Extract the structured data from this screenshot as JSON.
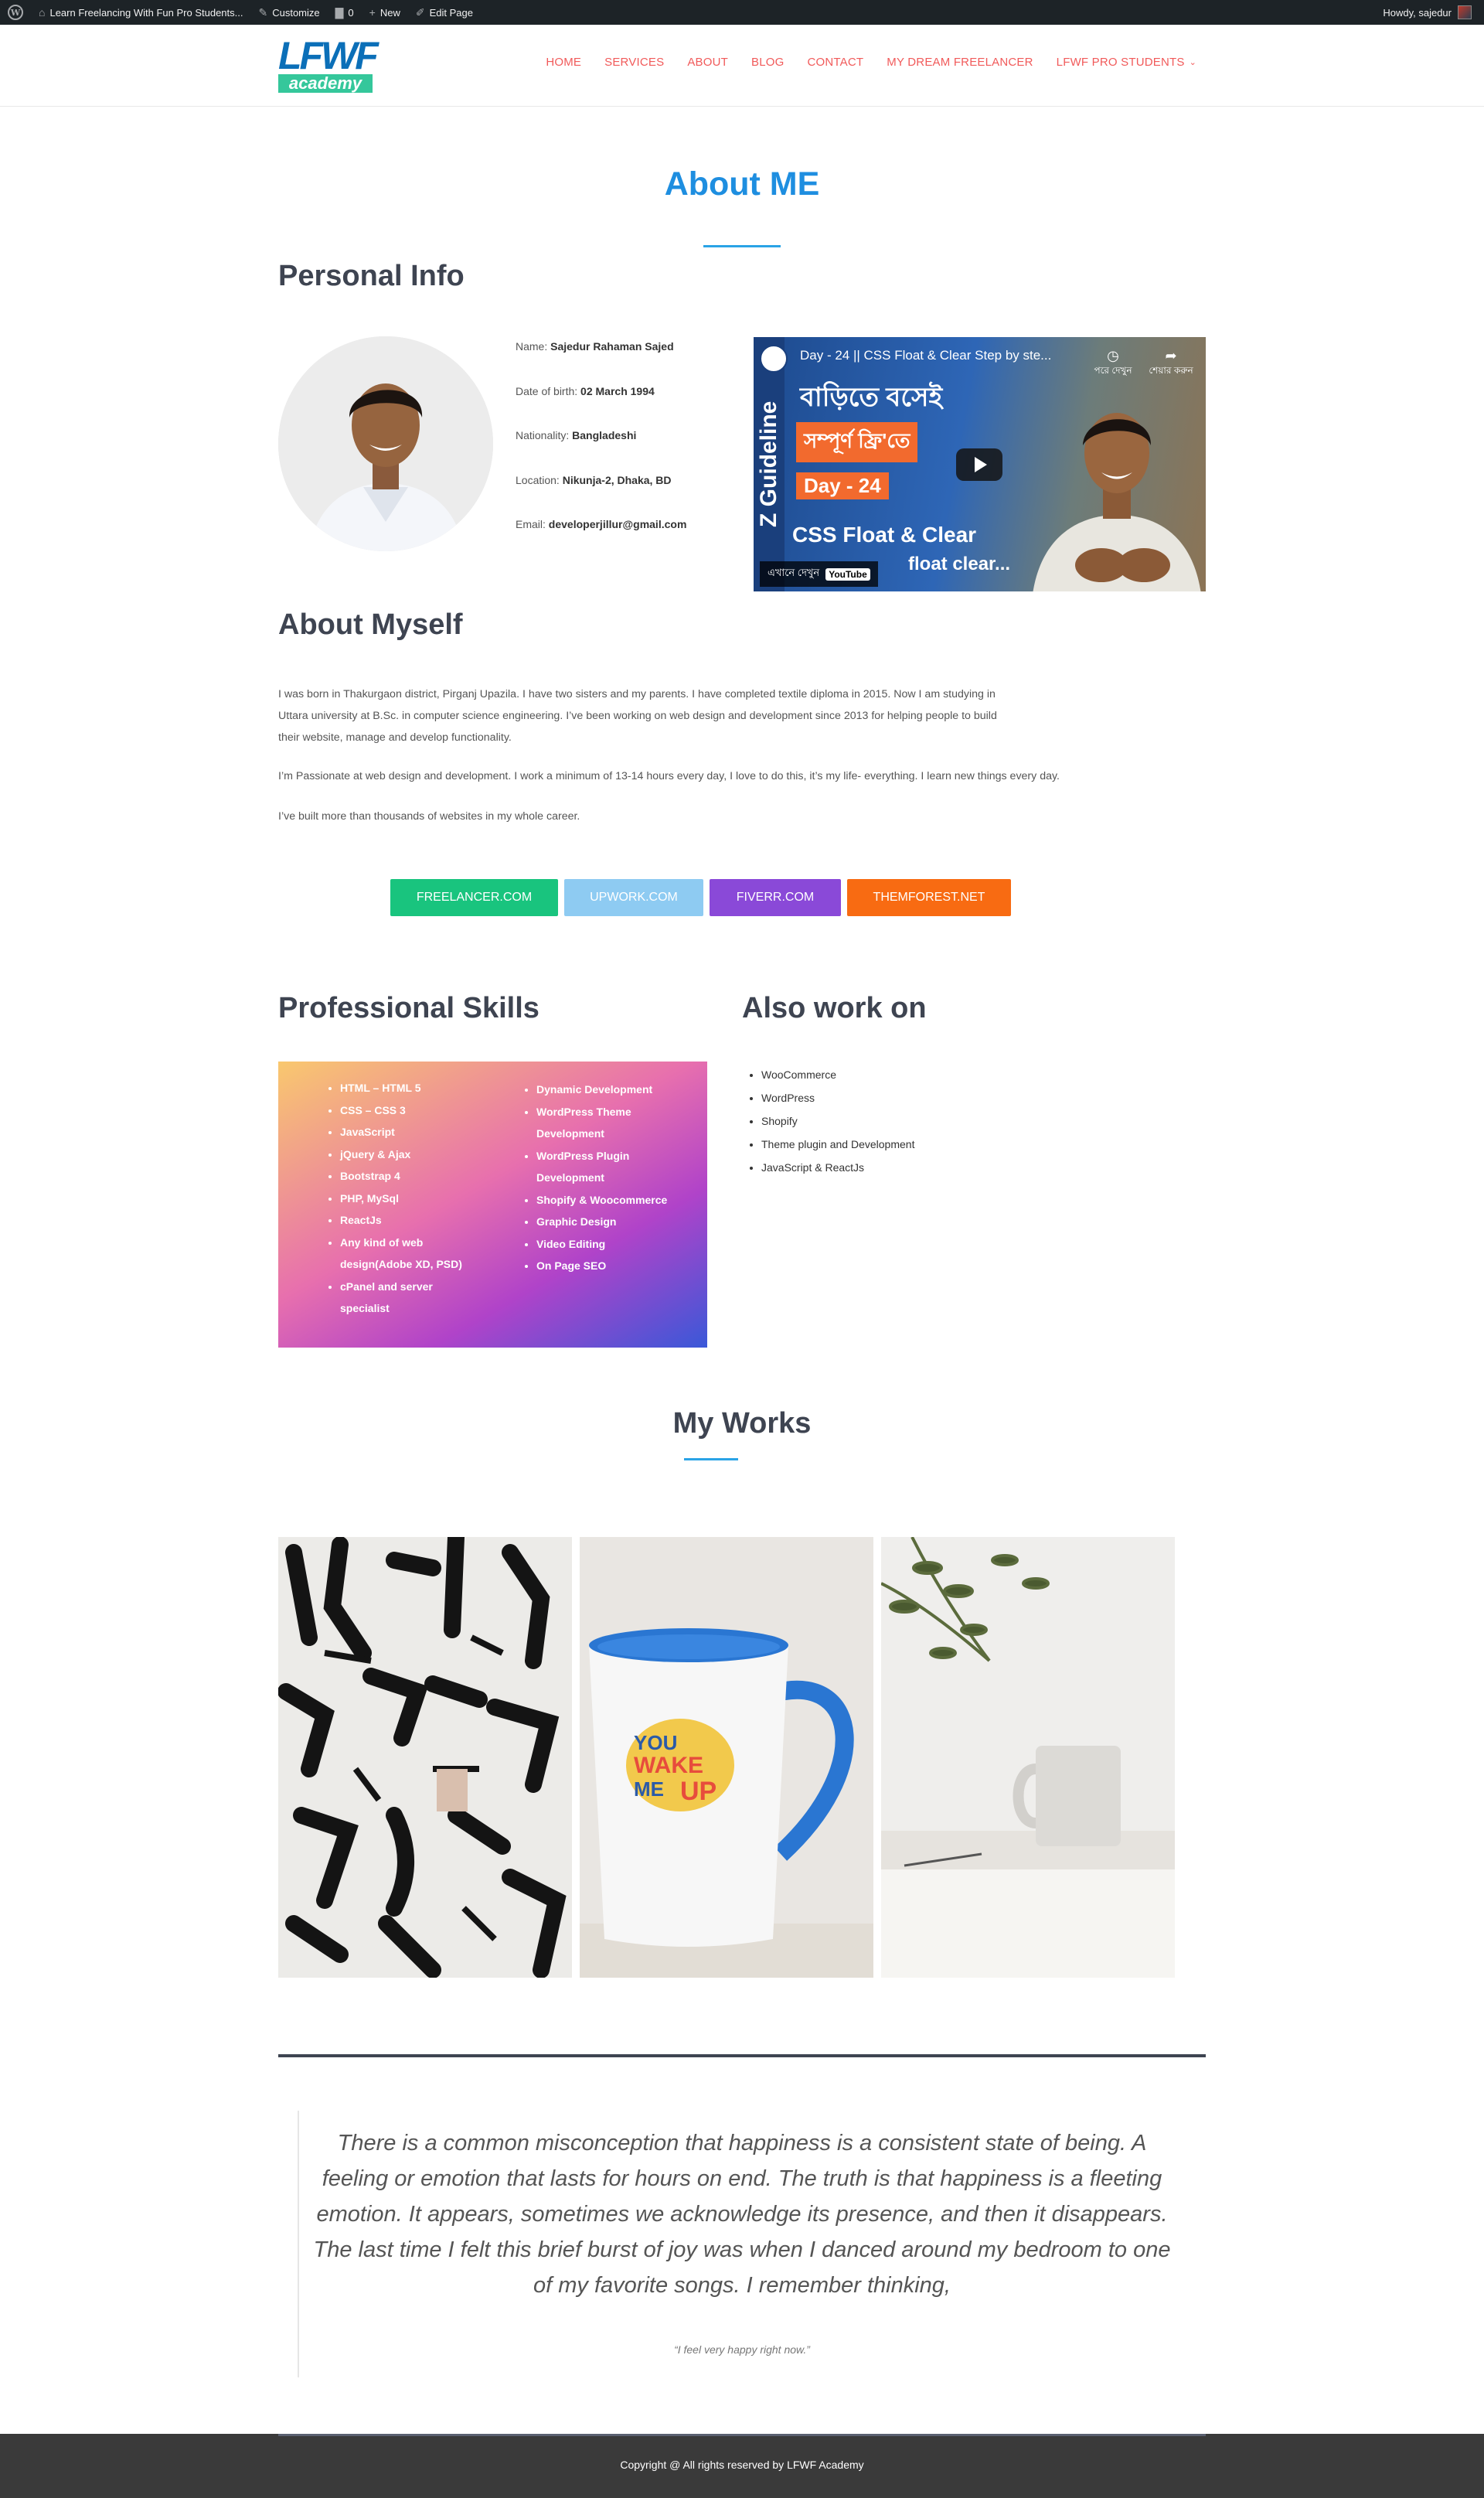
{
  "admin_bar": {
    "site_name": "Learn Freelancing With Fun Pro Students...",
    "customize": "Customize",
    "comments": "0",
    "new": "New",
    "edit_page": "Edit Page",
    "howdy": "Howdy, sajedur"
  },
  "header": {
    "logo_top": "LFWF",
    "logo_bottom": "academy",
    "nav": [
      "HOME",
      "SERVICES",
      "ABOUT",
      "BLOG",
      "CONTACT",
      "MY DREAM FREELANCER",
      "LFWF PRO STUDENTS"
    ]
  },
  "about": {
    "title": "About ME"
  },
  "personal": {
    "heading": "Personal Info",
    "fields": [
      {
        "label": "Name:",
        "value": "Sajedur Rahaman Sajed"
      },
      {
        "label": "Date of birth:",
        "value": "02 March 1994"
      },
      {
        "label": "Nationality:",
        "value": "Bangladeshi"
      },
      {
        "label": "Location:",
        "value": "Nikunja-2, Dhaka, BD"
      },
      {
        "label": "Email:",
        "value": "developerjillur@gmail.com"
      }
    ]
  },
  "video": {
    "title": "Day - 24 || CSS Float & Clear Step by ste...",
    "side_text": "Z Guideline",
    "line1": "বাড়িতে বসেই",
    "line2": "সম্পূর্ণ ফ্রি'তে",
    "line3": "Day - 24",
    "line4": "CSS Float & Clear",
    "line5": "float clear...",
    "watch_later": "পরে দেখুন",
    "share": "শেয়ার করুন",
    "watch_on": "এখানে দেখুন",
    "youtube": "YouTube"
  },
  "myself": {
    "heading": "About Myself",
    "p1_l1": "I was born in Thakurgaon district, Pirganj Upazila. I have two sisters and my parents. I have completed textile diploma in 2015. Now I am studying in",
    "p1_l2": "Uttara university at B.Sc. in computer science engineering. I’ve been working on web design and development since 2013 for helping people to build",
    "p1_l3": "their website, manage and develop functionality.",
    "p2": "I’m Passionate at web design and development. I work a minimum of 13-14 hours every day, I love to do this, it’s my life- everything. I learn new things every day.",
    "p3": "I’ve built more than thousands of websites in my whole career."
  },
  "buttons": [
    {
      "label": "FREELANCER.COM",
      "color": "#19c47e"
    },
    {
      "label": "UPWORK.COM",
      "color": "#8ecbf2"
    },
    {
      "label": "FIVERR.COM",
      "color": "#8a49d8"
    },
    {
      "label": "THEMFOREST.NET",
      "color": "#f86b12"
    }
  ],
  "skills": {
    "heading": "Professional Skills",
    "left": [
      "HTML – HTML 5",
      "CSS – CSS 3",
      "JavaScript",
      "jQuery & Ajax",
      "Bootstrap 4",
      "PHP, MySql",
      "ReactJs",
      "Any kind of web",
      "design(Adobe XD, PSD)",
      "cPanel and server",
      "specialist"
    ],
    "right": [
      "Dynamic Development",
      "WordPress Theme",
      "Development",
      "WordPress Plugin",
      "Development",
      "Shopify & Woocommerce",
      "Graphic Design",
      "Video Editing",
      "On Page SEO"
    ]
  },
  "also": {
    "heading": "Also work on",
    "items": [
      "WooCommerce",
      "WordPress",
      "Shopify",
      "Theme plugin and Development",
      "JavaScript & ReactJs"
    ]
  },
  "works": {
    "heading": "My Works",
    "mug_text": [
      "YOU",
      "WAKE",
      "ME",
      "UP"
    ]
  },
  "quote": {
    "text": "There is a common misconception that happiness is a consistent state of being. A feeling or emotion that lasts for hours on end. The truth is that happiness is a fleeting emotion. It appears, sometimes we acknowledge its presence, and then it disappears. The last time I felt this brief burst of joy was when I danced around my bedroom to one of my favorite songs. I remember thinking,",
    "cite": "“I feel very happy right now.”"
  },
  "footer": {
    "copyright": "Copyright @ All rights reserved by LFWF Academy"
  }
}
